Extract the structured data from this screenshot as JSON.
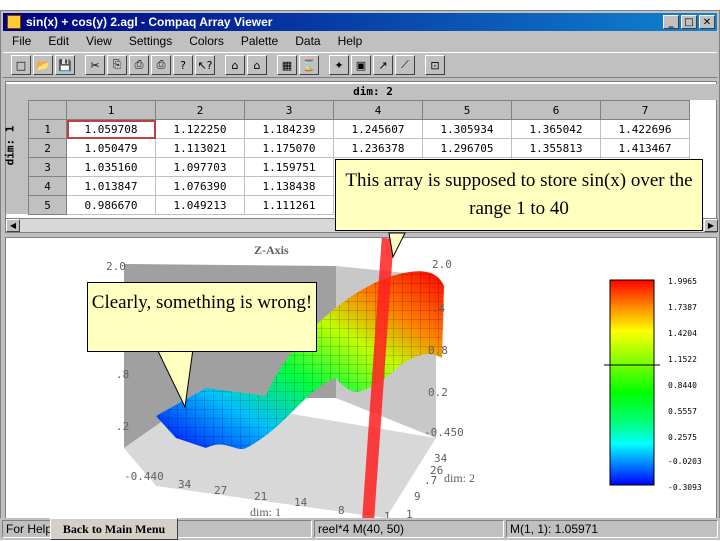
{
  "window": {
    "title": "sin(x) + cos(y) 2.agl - Compaq Array Viewer",
    "controls": [
      "_",
      "□",
      "✕"
    ]
  },
  "menu": [
    "File",
    "Edit",
    "View",
    "Settings",
    "Colors",
    "Palette",
    "Data",
    "Help"
  ],
  "toolbar": [
    "□",
    "📂",
    "💾",
    "✂",
    "⎘",
    "⎙",
    "⎙",
    "?",
    "↖?",
    "⌂",
    "⌂",
    "▦",
    "⌛",
    "✦",
    "▣",
    "↗",
    "⟋",
    "⊡"
  ],
  "spreadsheet": {
    "dim_top": "dim: 2",
    "dim_left": "dim: 1",
    "columns": [
      "1",
      "2",
      "3",
      "4",
      "5",
      "6",
      "7"
    ],
    "rows": [
      {
        "label": "1",
        "cells": [
          "1.059708",
          "1.122250",
          "1.184239",
          "1.245607",
          "1.305934",
          "1.365042",
          "1.422696"
        ]
      },
      {
        "label": "2",
        "cells": [
          "1.050479",
          "1.113021",
          "1.175070",
          "1.236378",
          "1.296705",
          "1.355813",
          "1.413467"
        ]
      },
      {
        "label": "3",
        "cells": [
          "1.035160",
          "1.097703",
          "1.159751",
          "",
          "",
          "",
          ""
        ]
      },
      {
        "label": "4",
        "cells": [
          "1.013847",
          "1.076390",
          "1.138438",
          "",
          "",
          "",
          ""
        ]
      },
      {
        "label": "5",
        "cells": [
          "0.986670",
          "1.049213",
          "1.111261",
          "",
          "",
          "",
          ""
        ]
      }
    ]
  },
  "callouts": {
    "top": "This array is supposed to store sin(x) over the range 1 to 40",
    "left": "Clearly, something is wrong!"
  },
  "plot": {
    "z_axis_label": "Z-Axis",
    "left_axis_ticks": [
      "2.0",
      ".8",
      ".2",
      "-0.440"
    ],
    "right_axis_ticks": [
      "2.0",
      ".4",
      "0.8",
      "0.2",
      "-0.450"
    ],
    "dim1_ticks": [
      "34",
      "27",
      "21",
      "14",
      "8",
      "1"
    ],
    "dim1_label": "dim: 1",
    "dim2_ticks": [
      "34",
      "26",
      ".7",
      "9",
      "1"
    ],
    "dim2_label": "dim: 2",
    "colorbar_labels": [
      "1.9965",
      "1.7387",
      "1.4204",
      "1.1522",
      "0.8440",
      "0.5557",
      "0.2575",
      "-0.0203",
      "-0.3093"
    ],
    "colorbar_colors": [
      "#ff0000",
      "#ff8000",
      "#ffff00",
      "#80ff00",
      "#00ff00",
      "#00ff80",
      "#00ffff",
      "#0080ff",
      "#0000ff"
    ]
  },
  "status": {
    "left": "For Help",
    "middle": "reel*4 M(40, 50)",
    "right": "M(1, 1): 1.05971",
    "back_button": "Back to Main Menu"
  }
}
